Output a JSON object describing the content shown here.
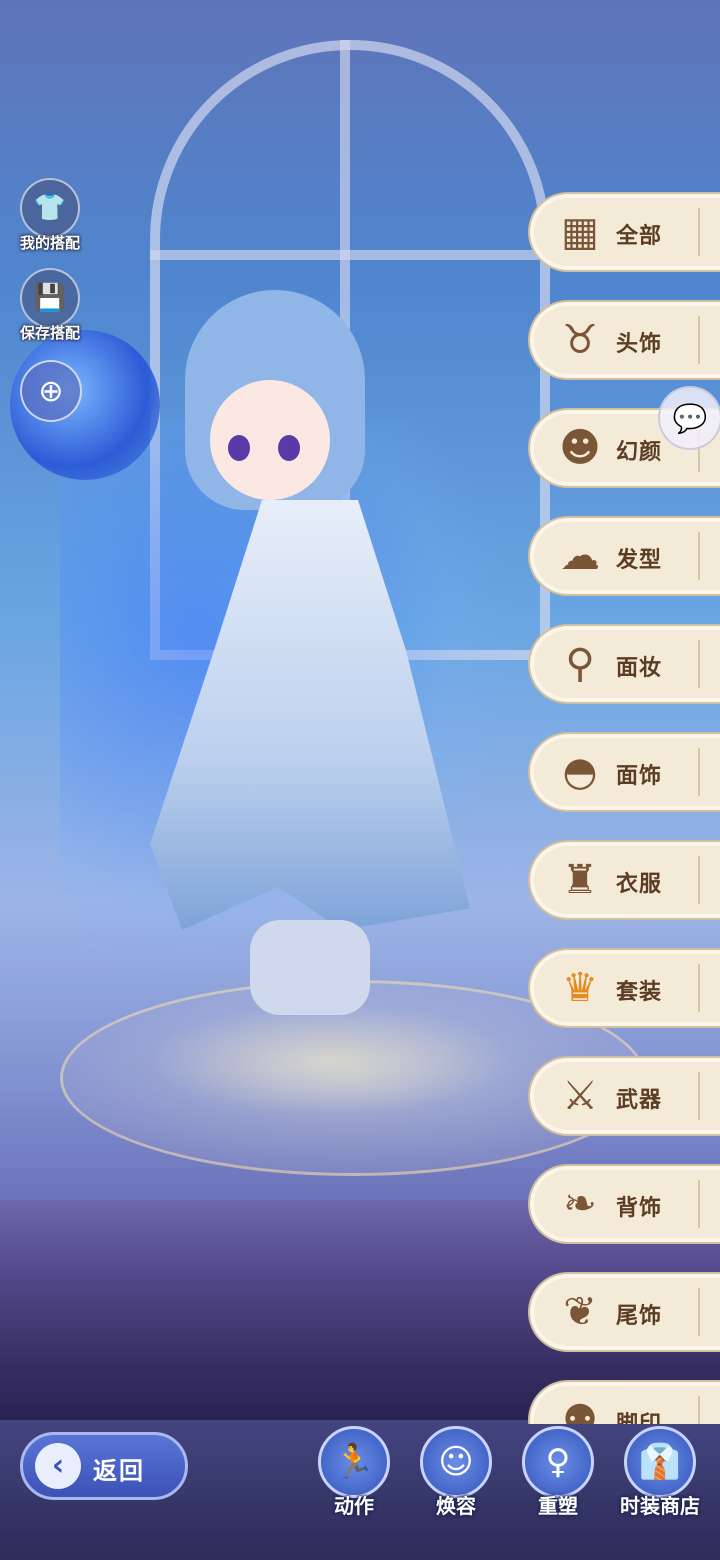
{
  "left_tools": {
    "outfits": {
      "label": "我的搭配",
      "icon": "shirt-icon"
    },
    "save": {
      "label": "保存搭配",
      "icon": "save-icon"
    },
    "zoom": {
      "icon": "zoom-in-icon"
    }
  },
  "categories": [
    {
      "label": "全部",
      "icon": "grid-icon",
      "active": false
    },
    {
      "label": "头饰",
      "icon": "headwear-icon",
      "active": false
    },
    {
      "label": "幻颜",
      "icon": "mask-face-icon",
      "active": false
    },
    {
      "label": "发型",
      "icon": "hair-icon",
      "active": false
    },
    {
      "label": "面妆",
      "icon": "mirror-icon",
      "active": false
    },
    {
      "label": "面饰",
      "icon": "face-mask-icon",
      "active": false
    },
    {
      "label": "衣服",
      "icon": "jacket-icon",
      "active": false
    },
    {
      "label": "套装",
      "icon": "dress-icon",
      "active": true
    },
    {
      "label": "武器",
      "icon": "sword-icon",
      "active": false
    },
    {
      "label": "背饰",
      "icon": "wing-icon",
      "active": false
    },
    {
      "label": "尾饰",
      "icon": "tail-icon",
      "active": false
    },
    {
      "label": "脚印",
      "icon": "footprint-icon",
      "active": false
    }
  ],
  "chat": {
    "icon": "chat-icon"
  },
  "bottom": {
    "back_label": "返回",
    "actions": [
      {
        "label": "动作",
        "icon": "pose-icon"
      },
      {
        "label": "焕容",
        "icon": "face-icon"
      },
      {
        "label": "重塑",
        "icon": "body-icon"
      },
      {
        "label": "时装商店",
        "icon": "shop-icon"
      }
    ]
  },
  "colors": {
    "tab_bg": "#f4ead8",
    "tab_text": "#5c3d24",
    "active_icon": "#e58a1c",
    "button_blue": "#4466c8"
  }
}
